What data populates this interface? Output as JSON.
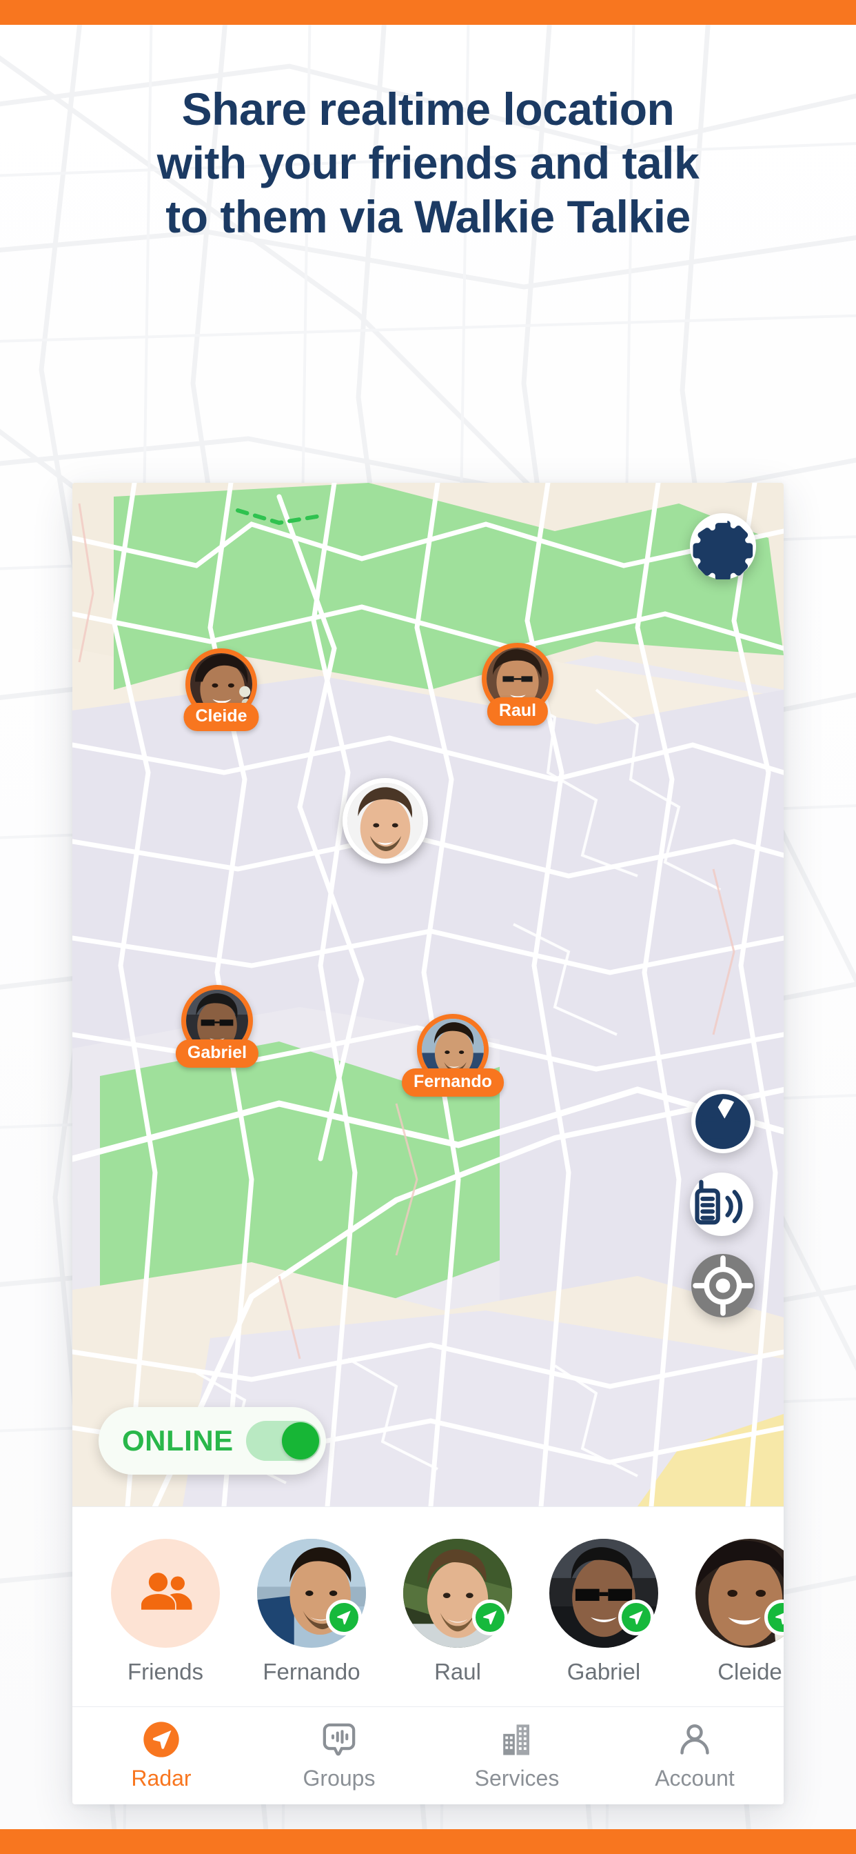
{
  "theme": {
    "brand_orange": "#f8761f",
    "navy": "#1b3a63",
    "online_green": "#29b74a",
    "nav_inactive": "#8b9096"
  },
  "headline": {
    "line1": "Share realtime location",
    "line2": "with your friends and talk",
    "line3": "to them via Walkie Talkie"
  },
  "map": {
    "settings_icon": "gear-icon",
    "camera_icon": "aperture-icon",
    "walkie_icon": "walkie-talkie-icon",
    "locate_icon": "crosshair-icon",
    "pins": [
      {
        "name": "Cleide",
        "self": false
      },
      {
        "name": "Raul",
        "self": false
      },
      {
        "name": "",
        "self": true
      },
      {
        "name": "Gabriel",
        "self": false
      },
      {
        "name": "Fernando",
        "self": false
      }
    ],
    "online": {
      "label": "ONLINE",
      "enabled": true
    }
  },
  "friends_strip": {
    "add_label": "Friends",
    "add_icon": "people-icon",
    "items": [
      {
        "name": "Fernando",
        "online": true
      },
      {
        "name": "Raul",
        "online": true
      },
      {
        "name": "Gabriel",
        "online": true
      },
      {
        "name": "Cleide",
        "online": true
      }
    ]
  },
  "navbar": {
    "items": [
      {
        "label": "Radar",
        "icon": "navigation-arrow-icon",
        "active": true
      },
      {
        "label": "Groups",
        "icon": "chat-waveform-icon",
        "active": false
      },
      {
        "label": "Services",
        "icon": "buildings-icon",
        "active": false
      },
      {
        "label": "Account",
        "icon": "person-icon",
        "active": false
      }
    ]
  }
}
